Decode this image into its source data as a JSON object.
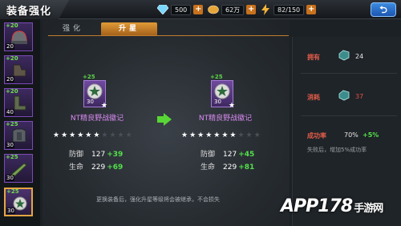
{
  "header": {
    "title": "装备强化",
    "diamonds": "500",
    "gold": "62万",
    "energy": "82/150",
    "back_label": "⮌"
  },
  "tabs": [
    {
      "label": "强化",
      "active": false
    },
    {
      "label": "升星",
      "active": true
    }
  ],
  "equipment_slots": [
    {
      "plus": "+20",
      "level": "20",
      "icon": "helmet-icon",
      "selected": false
    },
    {
      "plus": "+20",
      "level": "20",
      "icon": "gloves-icon",
      "selected": false
    },
    {
      "plus": "+20",
      "level": "40",
      "icon": "boots-icon",
      "selected": false
    },
    {
      "plus": "+25",
      "level": "30",
      "icon": "armor-icon",
      "selected": false
    },
    {
      "plus": "+25",
      "level": "30",
      "icon": "knife-icon",
      "selected": false
    },
    {
      "plus": "+25",
      "level": "30",
      "icon": "medal-icon",
      "selected": true
    }
  ],
  "current_item": {
    "plus": "+25",
    "level": "30",
    "name": "NT精良野战徽记",
    "stars_on": 6,
    "stars_total": 10,
    "stats": [
      {
        "label": "防御",
        "value": "127",
        "bonus": "+39"
      },
      {
        "label": "生命",
        "value": "229",
        "bonus": "+69"
      }
    ]
  },
  "next_item": {
    "plus": "+25",
    "level": "30",
    "name": "NT精良野战徽记",
    "stars_on": 7,
    "stars_total": 10,
    "stats": [
      {
        "label": "防御",
        "value": "127",
        "bonus": "+45"
      },
      {
        "label": "生命",
        "value": "229",
        "bonus": "+81"
      }
    ]
  },
  "info": {
    "owned_label": "拥有",
    "owned_value": "24",
    "cost_label": "消耗",
    "cost_value": "37",
    "rate_label": "成功率",
    "rate_value": "70%",
    "rate_bonus": "+5%",
    "fail_note": "失败后，增加5%成功率"
  },
  "footer_note": "更换装备后，强化升星等级将会被继承，不会损失",
  "watermark": {
    "main": "APP178",
    "sub": "手游网"
  },
  "colors": {
    "accent": "#e09a37",
    "bonus_green": "#52e04a",
    "item_name": "#d98af2",
    "label_red": "#e35c4a"
  }
}
